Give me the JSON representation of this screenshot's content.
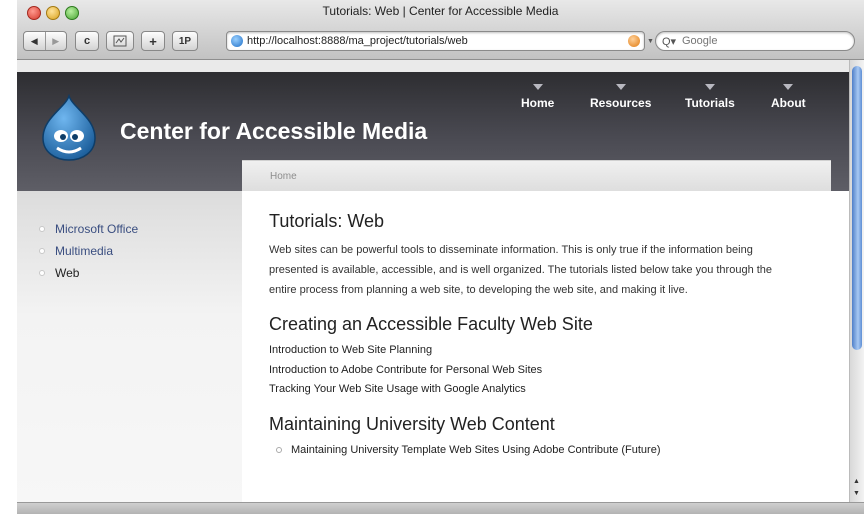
{
  "window": {
    "title": "Tutorials: Web | Center for Accessible Media"
  },
  "toolbar": {
    "back_icon": "back-arrow-icon",
    "forward_icon": "forward-arrow-icon",
    "reload_glyph": "c",
    "add_glyph": "+",
    "onepassword_label": "1P",
    "url": "http://localhost:8888/ma_project/tutorials/web",
    "search_placeholder": "Google",
    "search_prefix": "Q▾"
  },
  "site": {
    "name": "Center for Accessible Media",
    "nav": [
      {
        "label": "Home"
      },
      {
        "label": "Resources"
      },
      {
        "label": "Tutorials"
      },
      {
        "label": "About"
      }
    ]
  },
  "breadcrumb": {
    "home": "Home"
  },
  "sidebar": {
    "items": [
      {
        "label": "Microsoft Office"
      },
      {
        "label": "Multimedia"
      },
      {
        "label": "Web"
      }
    ]
  },
  "content": {
    "title": "Tutorials: Web",
    "intro": "Web sites can be powerful tools to disseminate information. This is only true if the information being presented is available, accessible, and is well organized. The tutorials listed below take you through the entire process from planning a web site, to developing the web site, and making it live.",
    "section1": {
      "heading": "Creating an Accessible Faculty Web Site",
      "links": [
        "Introduction to Web Site Planning",
        "Introduction to Adobe Contribute for Personal Web Sites",
        "Tracking Your Web Site Usage with Google Analytics"
      ]
    },
    "section2": {
      "heading": "Maintaining University Web Content",
      "items": [
        "Maintaining University Template Web Sites Using Adobe Contribute (Future)"
      ]
    }
  }
}
